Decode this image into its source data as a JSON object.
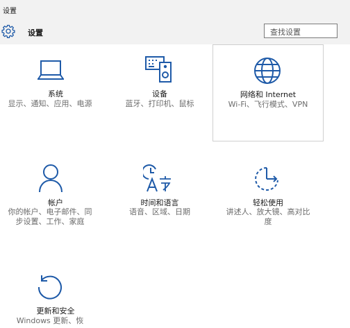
{
  "window": {
    "title": "设置"
  },
  "header": {
    "title": "设置",
    "icon": "gear-icon"
  },
  "search": {
    "placeholder": "查找设置"
  },
  "accent_color": "#1e5aa8",
  "tiles": [
    {
      "id": "system",
      "title": "系统",
      "desc": "显示、通知、应用、电源",
      "icon": "laptop-icon"
    },
    {
      "id": "devices",
      "title": "设备",
      "desc": "蓝牙、打印机、鼠标",
      "icon": "devices-icon"
    },
    {
      "id": "network",
      "title": "网络和 Internet",
      "desc": "Wi-Fi、飞行模式、VPN",
      "icon": "globe-icon"
    },
    {
      "id": "accounts",
      "title": "帐户",
      "desc": "你的帐户、电子邮件、同步设置、工作、家庭",
      "icon": "person-icon"
    },
    {
      "id": "time_language",
      "title": "时间和语言",
      "desc": "语音、区域、日期",
      "icon": "time-language-icon"
    },
    {
      "id": "ease_of_access",
      "title": "轻松使用",
      "desc": "讲述人、放大镜、高对比度",
      "icon": "ease-of-access-icon"
    },
    {
      "id": "update_security",
      "title": "更新和安全",
      "desc": "Windows 更新、恢",
      "icon": "update-icon"
    }
  ]
}
